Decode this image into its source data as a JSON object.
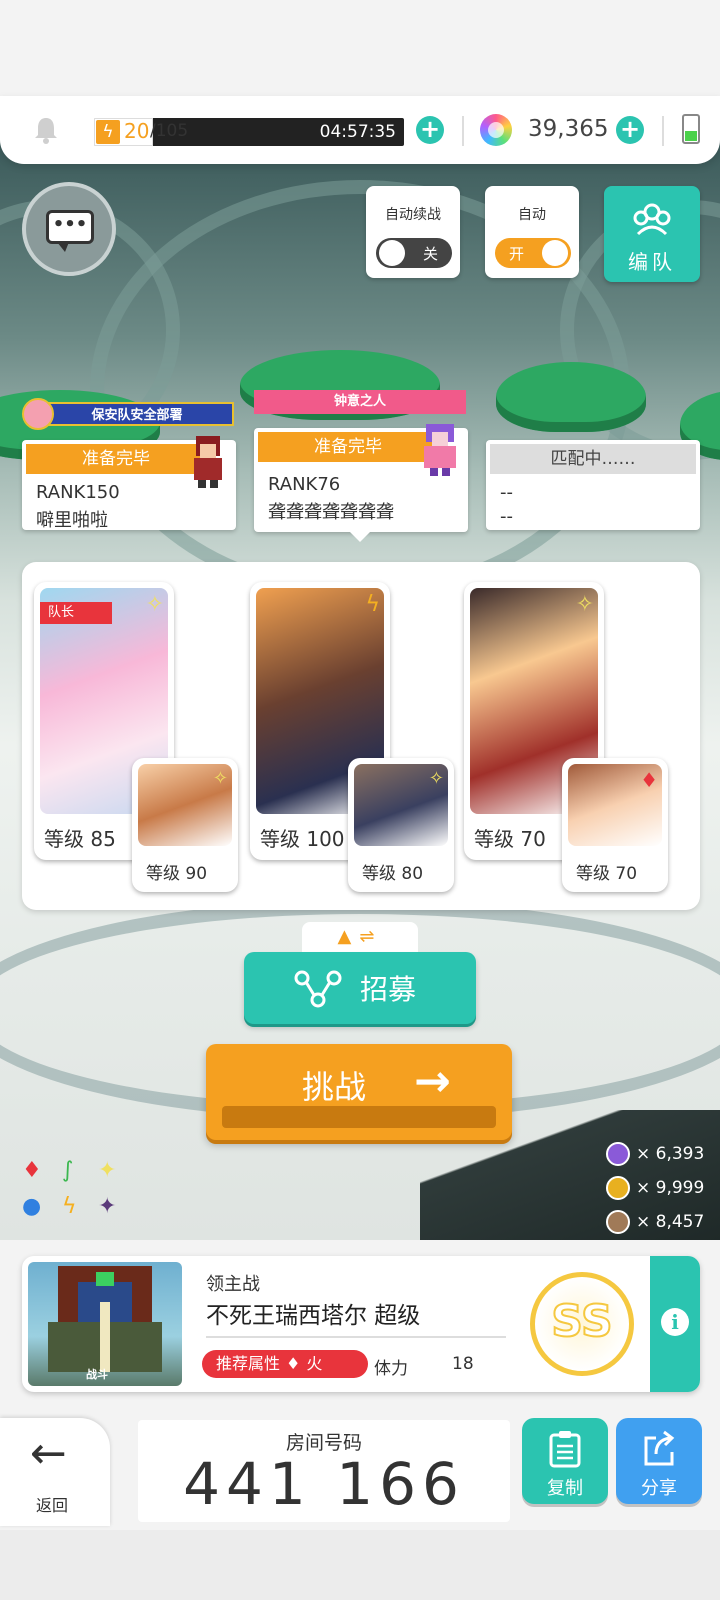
{
  "status": {
    "stamina_current": "20",
    "stamina_max": "/105",
    "stamina_fraction": 0.19,
    "timer": "04:57:35",
    "gems": "39,365",
    "battery_level": 0.4
  },
  "controls": {
    "auto_continue_label": "自动续战",
    "auto_continue_state": "关",
    "auto_label": "自动",
    "auto_state": "开",
    "team_label": "编队"
  },
  "players": [
    {
      "title": "保安队安全部署",
      "status": "准备完毕",
      "rank": "RANK150",
      "name": "噼里啪啦"
    },
    {
      "title": "钟意之人",
      "status": "准备完毕",
      "rank": "RANK76",
      "name": "聋聋聋聋聋聋聋"
    },
    {
      "title": "",
      "status": "匹配中……",
      "rank": "--",
      "name": "--"
    }
  ],
  "party": {
    "captain_label": "队长",
    "characters": [
      {
        "level": "等级 85",
        "element": "✧"
      },
      {
        "level": "等级 90",
        "element": "✧"
      },
      {
        "level": "等级 100",
        "element": "ϟ"
      },
      {
        "level": "等级 80",
        "element": "✧"
      },
      {
        "level": "等级 70",
        "element": "✧"
      },
      {
        "level": "等级 70",
        "element": "♦"
      }
    ]
  },
  "actions": {
    "recruit_label": "招募",
    "challenge_label": "挑战",
    "challenge_arrow": "→"
  },
  "currencies": [
    {
      "value": "× 6,393",
      "color": "#8a5ad8"
    },
    {
      "value": "× 9,999",
      "color": "#e8b020"
    },
    {
      "value": "× 8,457",
      "color": "#a07a58"
    }
  ],
  "boss": {
    "type": "领主战",
    "name": "不死王瑞西塔尔 超级",
    "recommend_label": "推荐属性",
    "recommend_element": "火",
    "stamina_label": "体力",
    "stamina_value": "18",
    "grade": "SS",
    "portrait_tag": "战斗"
  },
  "room": {
    "label": "房间号码",
    "number": "441 166"
  },
  "bottom": {
    "back_label": "返回",
    "copy_label": "复制",
    "share_label": "分享"
  },
  "colors": {
    "teal": "#2bc4b0",
    "orange": "#f5a020",
    "red": "#e8343c",
    "blue": "#40a0f0"
  }
}
